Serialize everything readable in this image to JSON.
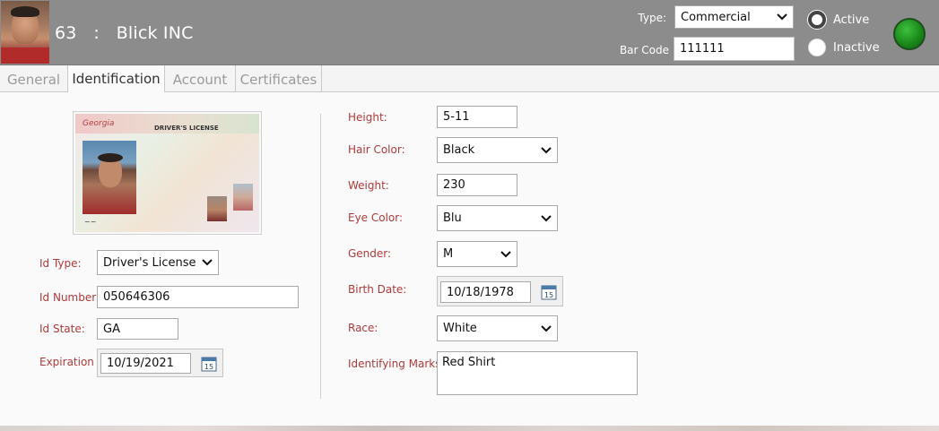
{
  "header": {
    "record_number": "63",
    "separator": ":",
    "company_name": "Blick INC",
    "type_label": "Type:",
    "type_value": "Commercial",
    "barcode_label": "Bar Code",
    "barcode_value": "111111",
    "status_options": [
      {
        "label": "Active",
        "selected": true
      },
      {
        "label": "Inactive",
        "selected": false
      }
    ],
    "status_light_color": "#1a8a1a"
  },
  "tabs": [
    {
      "label": "General",
      "active": false
    },
    {
      "label": "Identification",
      "active": true
    },
    {
      "label": "Account",
      "active": false
    },
    {
      "label": "Certificates",
      "active": false
    }
  ],
  "license_card": {
    "state_text": "Georgia",
    "title": "DRIVER'S LICENSE"
  },
  "left_form": {
    "id_type": {
      "label": "Id Type:",
      "value": "Driver's License"
    },
    "id_number": {
      "label": "Id Number:",
      "value": "050646306"
    },
    "id_state": {
      "label": "Id State:",
      "value": "GA"
    },
    "expiration": {
      "label": "Expiration",
      "value": "10/19/2021"
    }
  },
  "right_form": {
    "height": {
      "label": "Height:",
      "value": "5-11"
    },
    "hair_color": {
      "label": "Hair Color:",
      "value": "Black"
    },
    "weight": {
      "label": "Weight:",
      "value": "230"
    },
    "eye_color": {
      "label": "Eye Color:",
      "value": "Blu"
    },
    "gender": {
      "label": "Gender:",
      "value": "M"
    },
    "birth_date": {
      "label": "Birth Date:",
      "value": "10/18/1978"
    },
    "race": {
      "label": "Race:",
      "value": "White"
    },
    "identifying_marks": {
      "label": "Identifying Marks:",
      "value": "Red Shirt"
    }
  },
  "icons": {
    "dropdown": "chevron-down-icon",
    "calendar": "calendar-icon",
    "status": "status-light-icon"
  },
  "colors": {
    "header_bg": "#8c8c8c",
    "label_red": "#b03a3a",
    "tab_inactive": "#9a9a9a"
  }
}
